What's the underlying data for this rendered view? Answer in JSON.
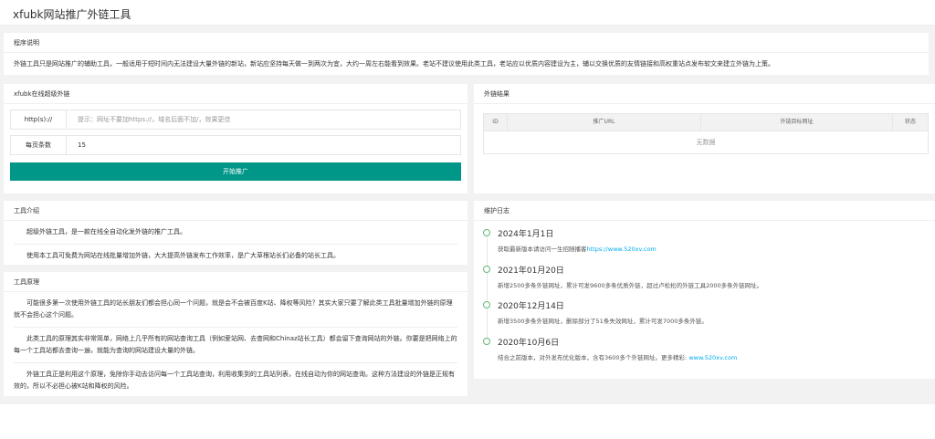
{
  "header": {
    "title": "xfubk网站推广外链工具"
  },
  "program_desc": {
    "heading": "程序说明",
    "text": "外链工具只是网站推广的辅助工具，一般适用于短时间内无法建设大量外链的新站，新站应坚持每天做一到两次为宜，大约一周左右能看到效果。老站不建议使用此类工具，老站应以优质内容建设为主，辅以交换优质的友情链接和高权重站点发布软文来建立外链为上策。"
  },
  "form": {
    "heading": "xfubk在线超级外链",
    "url_label": "http(s)://",
    "url_placeholder": "提示：网址不要加https://，域名后面不加/，效果更佳",
    "count_label": "每页条数",
    "count_value": "15",
    "submit_label": "开始推广"
  },
  "results": {
    "heading": "外链结果",
    "columns": [
      "ID",
      "推广URL",
      "外链目标网址",
      "状态"
    ],
    "empty_text": "无数据"
  },
  "intro": {
    "heading": "工具介绍",
    "p1": "超级外链工具，是一款在线全自动化发外链的推广工具。",
    "p2": "使用本工具可免费为网站在线批量增加外链，大大提高外链发布工作效率，是广大草根站长们必备的站长工具。"
  },
  "principle": {
    "heading": "工具原理",
    "p1": "可能很多第一次使用外链工具的站长朋友们都会担心同一个问题，就是会不会被百度K站、降权等风险？其实大家只要了解此类工具批量增加外链的原理就不会担心这个问题。",
    "p2": "此类工具的原理其实非常简单，网络上几乎所有的网站查询工具（例如爱站网、去查网和Chinaz站长工具）都会留下查询网站的外链。你要是把网络上的每一个工具站都去查询一遍，就能为查询的网站建设大量的外链。",
    "p3": "外链工具正是利用这个原理，免除你手动去访问每一个工具站查询，利用收集到的工具站列表，在线自动为你的网站查询。这种方法建设的外链是正规有效的，所以不必担心被K站和降权的风险。"
  },
  "log": {
    "heading": "维护日志",
    "entries": [
      {
        "date": "2024年1月1日",
        "text": "获取最新版本请访问一生招随播客",
        "link": "https://www.520xv.com"
      },
      {
        "date": "2021年01月20日",
        "text": "新增2500多条外链网址，累计可发9600多条优质外链，超过卢松松的外链工具2000多条外链网址。"
      },
      {
        "date": "2020年12月14日",
        "text": "新增3500多条外链网址，删除部分了51条失效网址，累计可发7000多条外链。"
      },
      {
        "date": "2020年10月6日",
        "text": "结合之前版本，对外发布优化版本，含有3600多个外链网址。更多精彩: ",
        "link": "www.520xv.com"
      }
    ]
  },
  "colors": {
    "primary": "#009688",
    "link": "#01aaed",
    "timeline": "#5fb878",
    "background": "#f2f2f2"
  }
}
